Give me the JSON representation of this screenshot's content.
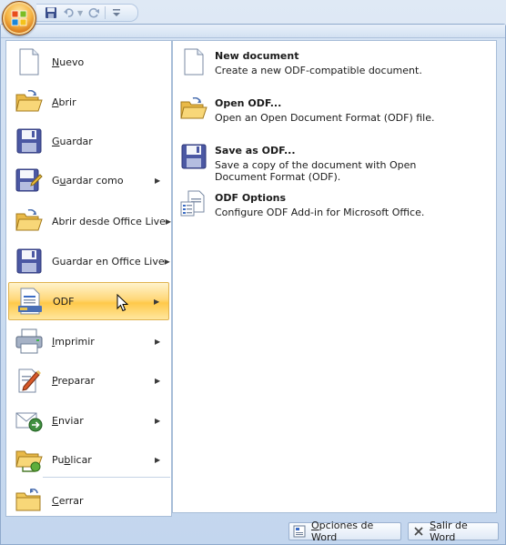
{
  "left_menu": {
    "items": [
      {
        "key": "nuevo",
        "pre": "",
        "mn": "N",
        "post": "uevo",
        "icon": "new-document-icon",
        "arrow": false
      },
      {
        "key": "abrir",
        "pre": "",
        "mn": "A",
        "post": "brir",
        "icon": "open-folder-icon",
        "arrow": false
      },
      {
        "key": "guardar",
        "pre": "",
        "mn": "G",
        "post": "uardar",
        "icon": "save-disk-icon",
        "arrow": false
      },
      {
        "key": "guardar-como",
        "pre": "G",
        "mn": "u",
        "post": "ardar como",
        "icon": "save-as-icon",
        "arrow": true
      },
      {
        "key": "abrir-office-live",
        "pre": "Abrir desde Office Live",
        "mn": "",
        "post": "",
        "icon": "open-office-live-icon",
        "arrow": true
      },
      {
        "key": "guardar-office-live",
        "pre": "Guardar en Office Live",
        "mn": "",
        "post": "",
        "icon": "save-office-live-icon",
        "arrow": true
      },
      {
        "key": "odf",
        "pre": "ODF",
        "mn": "",
        "post": "",
        "icon": "odf-document-icon",
        "arrow": true
      },
      {
        "key": "imprimir",
        "pre": "",
        "mn": "I",
        "post": "mprimir",
        "icon": "printer-icon",
        "arrow": true
      },
      {
        "key": "preparar",
        "pre": "",
        "mn": "P",
        "post": "reparar",
        "icon": "prepare-pen-icon",
        "arrow": true
      },
      {
        "key": "enviar",
        "pre": "",
        "mn": "E",
        "post": "nviar",
        "icon": "send-icon",
        "arrow": true
      },
      {
        "key": "publicar",
        "pre": "Pu",
        "mn": "b",
        "post": "licar",
        "icon": "publish-icon",
        "arrow": true
      },
      {
        "key": "cerrar",
        "pre": "",
        "mn": "C",
        "post": "errar",
        "icon": "close-folder-icon",
        "arrow": false
      }
    ],
    "highlighted": "odf"
  },
  "submenu": {
    "items": [
      {
        "key": "new-document",
        "title": "New document",
        "desc": "Create a new ODF-compatible document.",
        "icon": "new-document-icon"
      },
      {
        "key": "open-odf",
        "title": "Open ODF...",
        "desc": "Open an Open Document Format (ODF) file.",
        "icon": "open-folder-icon"
      },
      {
        "key": "save-as-odf",
        "title": "Save as ODF...",
        "desc": "Save a copy of the document with Open Document Format (ODF).",
        "icon": "save-disk-icon"
      },
      {
        "key": "odf-options",
        "title": "ODF Options",
        "desc": "Configure ODF Add-in for Microsoft Office.",
        "icon": "odf-options-icon"
      }
    ]
  },
  "footer": {
    "options_pre": "",
    "options_mn": "O",
    "options_post": "pciones de Word",
    "exit_pre": "",
    "exit_mn": "S",
    "exit_post": "alir de Word"
  },
  "colors": {
    "highlight": "#ffd87a",
    "frame": "#c3d6ee",
    "orb": "#f6b443"
  }
}
